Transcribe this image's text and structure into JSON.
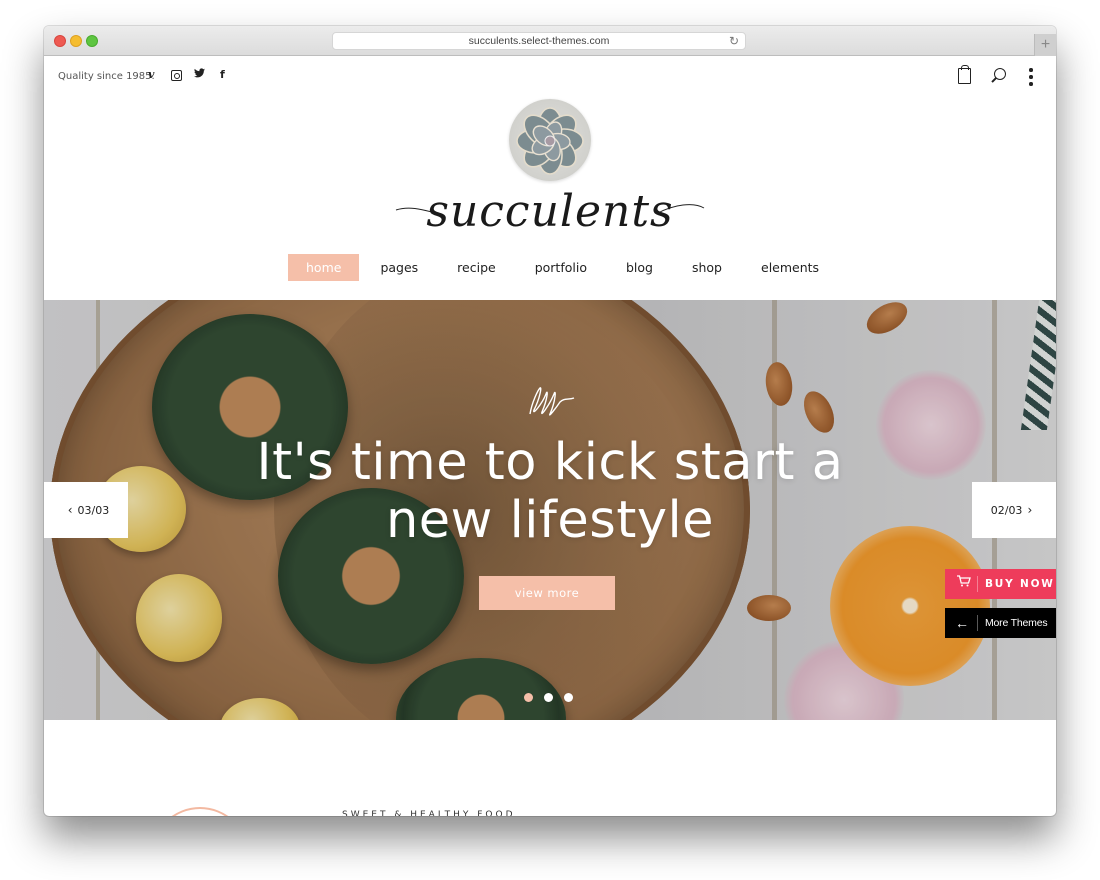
{
  "browser": {
    "url": "succulents.select-themes.com",
    "new_tab_label": "+"
  },
  "topbar": {
    "tagline": "Quality since 1985.",
    "social": [
      {
        "name": "vimeo-icon",
        "glyph": "v"
      },
      {
        "name": "instagram-icon",
        "glyph": ""
      },
      {
        "name": "twitter-icon",
        "glyph": "🐦"
      },
      {
        "name": "facebook-icon",
        "glyph": "f"
      }
    ]
  },
  "logo": {
    "wordmark": "succulents"
  },
  "nav": {
    "items": [
      {
        "label": "home",
        "active": true
      },
      {
        "label": "pages",
        "active": false
      },
      {
        "label": "recipe",
        "active": false
      },
      {
        "label": "portfolio",
        "active": false
      },
      {
        "label": "blog",
        "active": false
      },
      {
        "label": "shop",
        "active": false
      },
      {
        "label": "elements",
        "active": false
      }
    ]
  },
  "hero": {
    "headline_line1": "It's time to kick start a",
    "headline_line2": "new lifestyle",
    "cta_label": "view more",
    "prev_label": "03/03",
    "next_label": "02/03",
    "prev_glyph": "‹",
    "next_glyph": "›",
    "slides_total": 3,
    "active_slide": 1
  },
  "promo": {
    "buy_now_label": "BUY NOW",
    "buy_now_icon": "🛒",
    "more_themes_label": "More Themes",
    "more_themes_icon": "←"
  },
  "section": {
    "kicker": "SWEET & HEALTHY FOOD"
  },
  "colors": {
    "accent_peach": "#f5bfa9",
    "buy_now_red": "#ee3c5b",
    "more_themes_black": "#000000"
  }
}
